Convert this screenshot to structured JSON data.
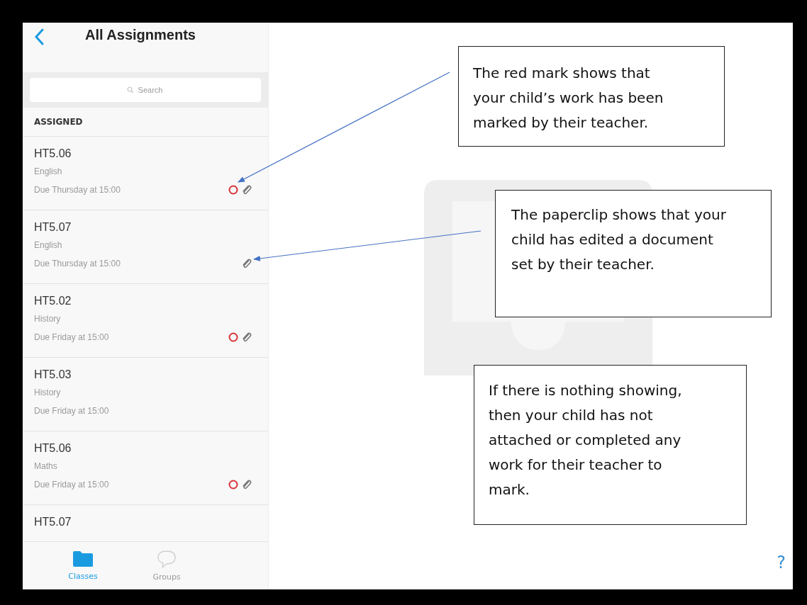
{
  "panel": {
    "title": "All Assignments",
    "search": {
      "placeholder": "Search"
    },
    "section": "ASSIGNED",
    "assignments": [
      {
        "title": "HT5.06",
        "subject": "English",
        "due": "Due Thursday at 15:00",
        "marked": true,
        "attached": true
      },
      {
        "title": "HT5.07",
        "subject": "English",
        "due": "Due Thursday at 15:00",
        "marked": false,
        "attached": true
      },
      {
        "title": "HT5.02",
        "subject": "History",
        "due": "Due Friday at 15:00",
        "marked": true,
        "attached": true
      },
      {
        "title": "HT5.03",
        "subject": "History",
        "due": "Due Friday at 15:00",
        "marked": false,
        "attached": false
      },
      {
        "title": "HT5.06",
        "subject": "Maths",
        "due": "Due Friday at 15:00",
        "marked": true,
        "attached": true
      },
      {
        "title": "HT5.07"
      }
    ],
    "tabs": [
      {
        "label": "Classes",
        "selected": true
      },
      {
        "label": "Groups",
        "selected": false
      }
    ]
  },
  "annotations": [
    {
      "text": "The red mark shows that your child’s work has been marked by their teacher."
    },
    {
      "text": "The paperclip shows that your child has edited a document set by their teacher."
    },
    {
      "text": "If there is nothing showing, then your child has not attached or completed any work for their teacher to mark."
    }
  ],
  "help": "?"
}
